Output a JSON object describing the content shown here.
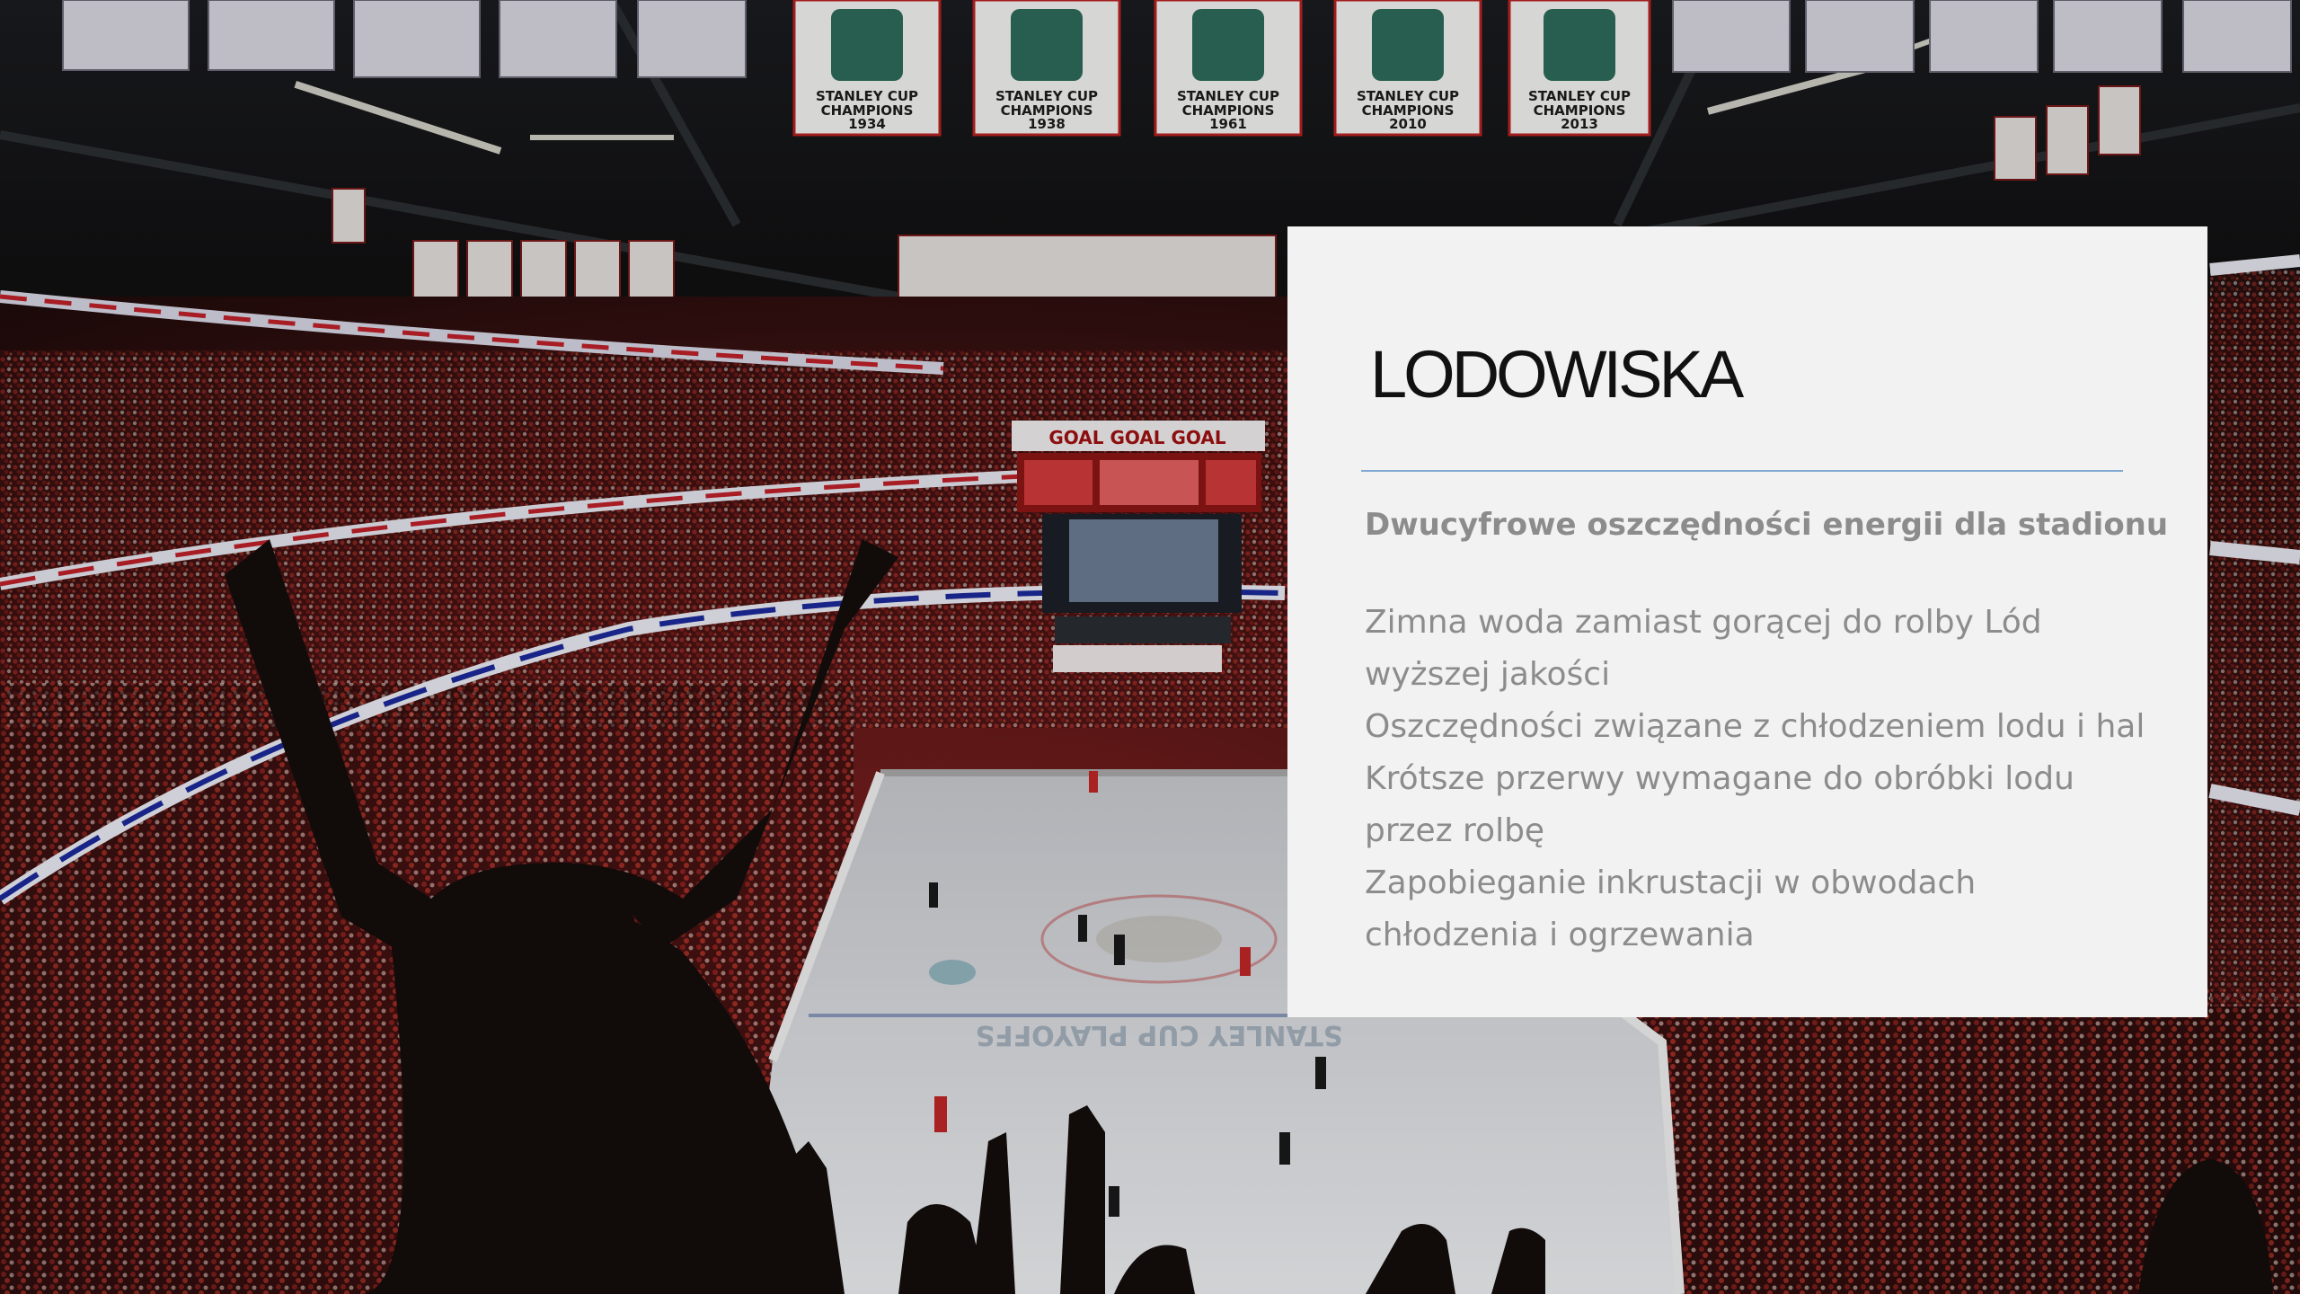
{
  "slide": {
    "title": "LODOWISKA",
    "subtitle": "Dwucyfrowe oszczędności energii dla stadionu",
    "bullets": [
      "Zimna woda zamiast gorącej do rolby Lód wyższej jakości",
      "Oszczędności związane z chłodzeniem lodu i hal",
      "Krótsze przerwy wymagane do obróbki lodu przez rolbę",
      "Zapobieganie inkrustacji w obwodach chłodzenia i ogrzewania"
    ]
  },
  "background": {
    "description_icon": "hockey-arena-photo",
    "banners": [
      "STANLEY CUP CHAMPIONS 1934",
      "STANLEY CUP CHAMPIONS 1938",
      "STANLEY CUP CHAMPIONS 1961",
      "STANLEY CUP CHAMPIONS 2010",
      "STANLEY CUP CHAMPIONS 2013"
    ],
    "ribbon_text": "GOAL GOAL GOAL",
    "ice_text": "STANLEY CUP PLAYOFFS"
  },
  "colors": {
    "card_bg": "#f2f2f2",
    "title": "#111111",
    "rule": "#7fa9d2",
    "body_text": "#8c8c8c",
    "crowd_red": "#8a1a1a",
    "ice": "#e8eaee"
  }
}
